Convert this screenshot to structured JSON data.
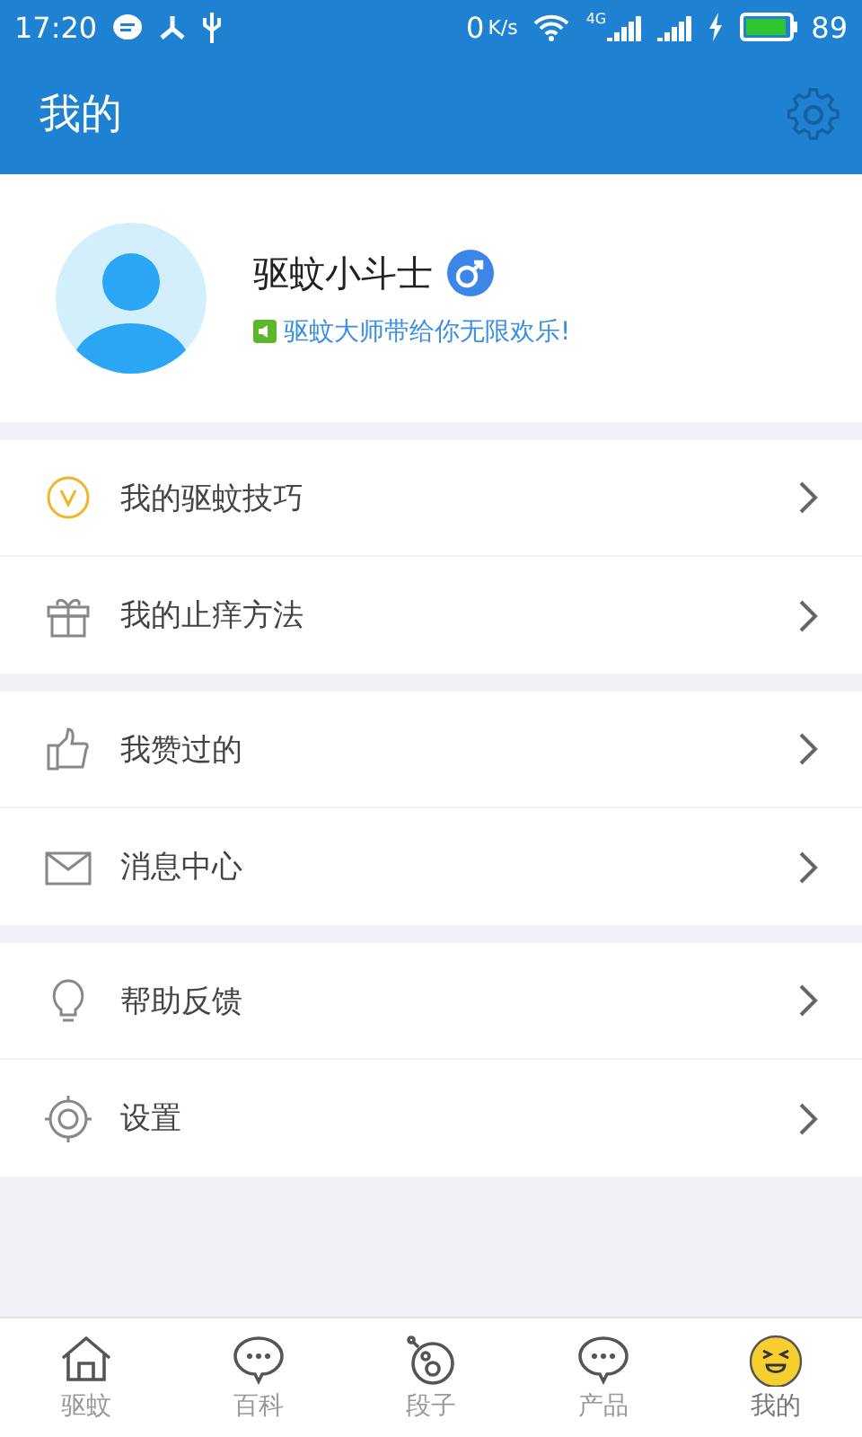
{
  "status_bar": {
    "time": "17:20",
    "speed_value": "0",
    "speed_unit": "K/s",
    "network": "4G",
    "battery": "89"
  },
  "header": {
    "title": "我的"
  },
  "profile": {
    "name": "驱蚊小斗士",
    "motto": "驱蚊大师带给你无限欢乐!"
  },
  "menu_groups": [
    {
      "items": [
        {
          "kind": "tips",
          "label": "我的驱蚊技巧"
        },
        {
          "kind": "gift",
          "label": "我的止痒方法"
        }
      ]
    },
    {
      "items": [
        {
          "kind": "like",
          "label": "我赞过的"
        },
        {
          "kind": "mail",
          "label": "消息中心"
        }
      ]
    },
    {
      "items": [
        {
          "kind": "bulb",
          "label": "帮助反馈"
        },
        {
          "kind": "settings",
          "label": "设置"
        }
      ]
    }
  ],
  "tabs": [
    {
      "kind": "home",
      "label": "驱蚊",
      "selected": false
    },
    {
      "kind": "chat",
      "label": "百科",
      "selected": false
    },
    {
      "kind": "bubble",
      "label": "段子",
      "selected": false
    },
    {
      "kind": "chat",
      "label": "产品",
      "selected": false
    },
    {
      "kind": "face",
      "label": "我的",
      "selected": true
    }
  ]
}
